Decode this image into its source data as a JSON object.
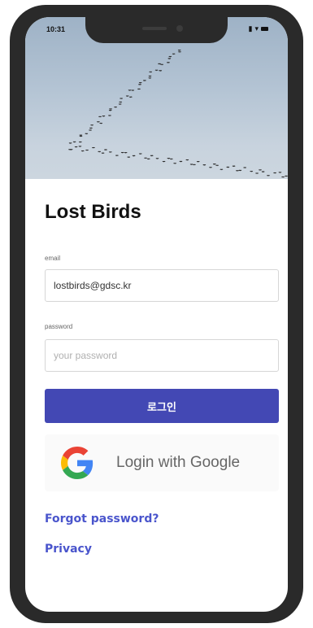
{
  "status_bar": {
    "time": "10:31",
    "signal_icon": "signal-icon",
    "wifi_icon": "wifi-icon",
    "battery_icon": "battery-icon"
  },
  "hero": {
    "description_icon": "flock-of-birds-image"
  },
  "app": {
    "title": "Lost Birds"
  },
  "form": {
    "email_label": "email",
    "email_value": "lostbirds@gdsc.kr",
    "password_label": "password",
    "password_placeholder": "your password",
    "login_label": "로그인"
  },
  "google": {
    "label": "Login with Google",
    "icon": "google-icon"
  },
  "links": {
    "forgot": "Forgot password?",
    "privacy": "Privacy"
  },
  "colors": {
    "primary": "#4348b4",
    "link": "#4a55cc",
    "frame": "#2a2a2a"
  }
}
